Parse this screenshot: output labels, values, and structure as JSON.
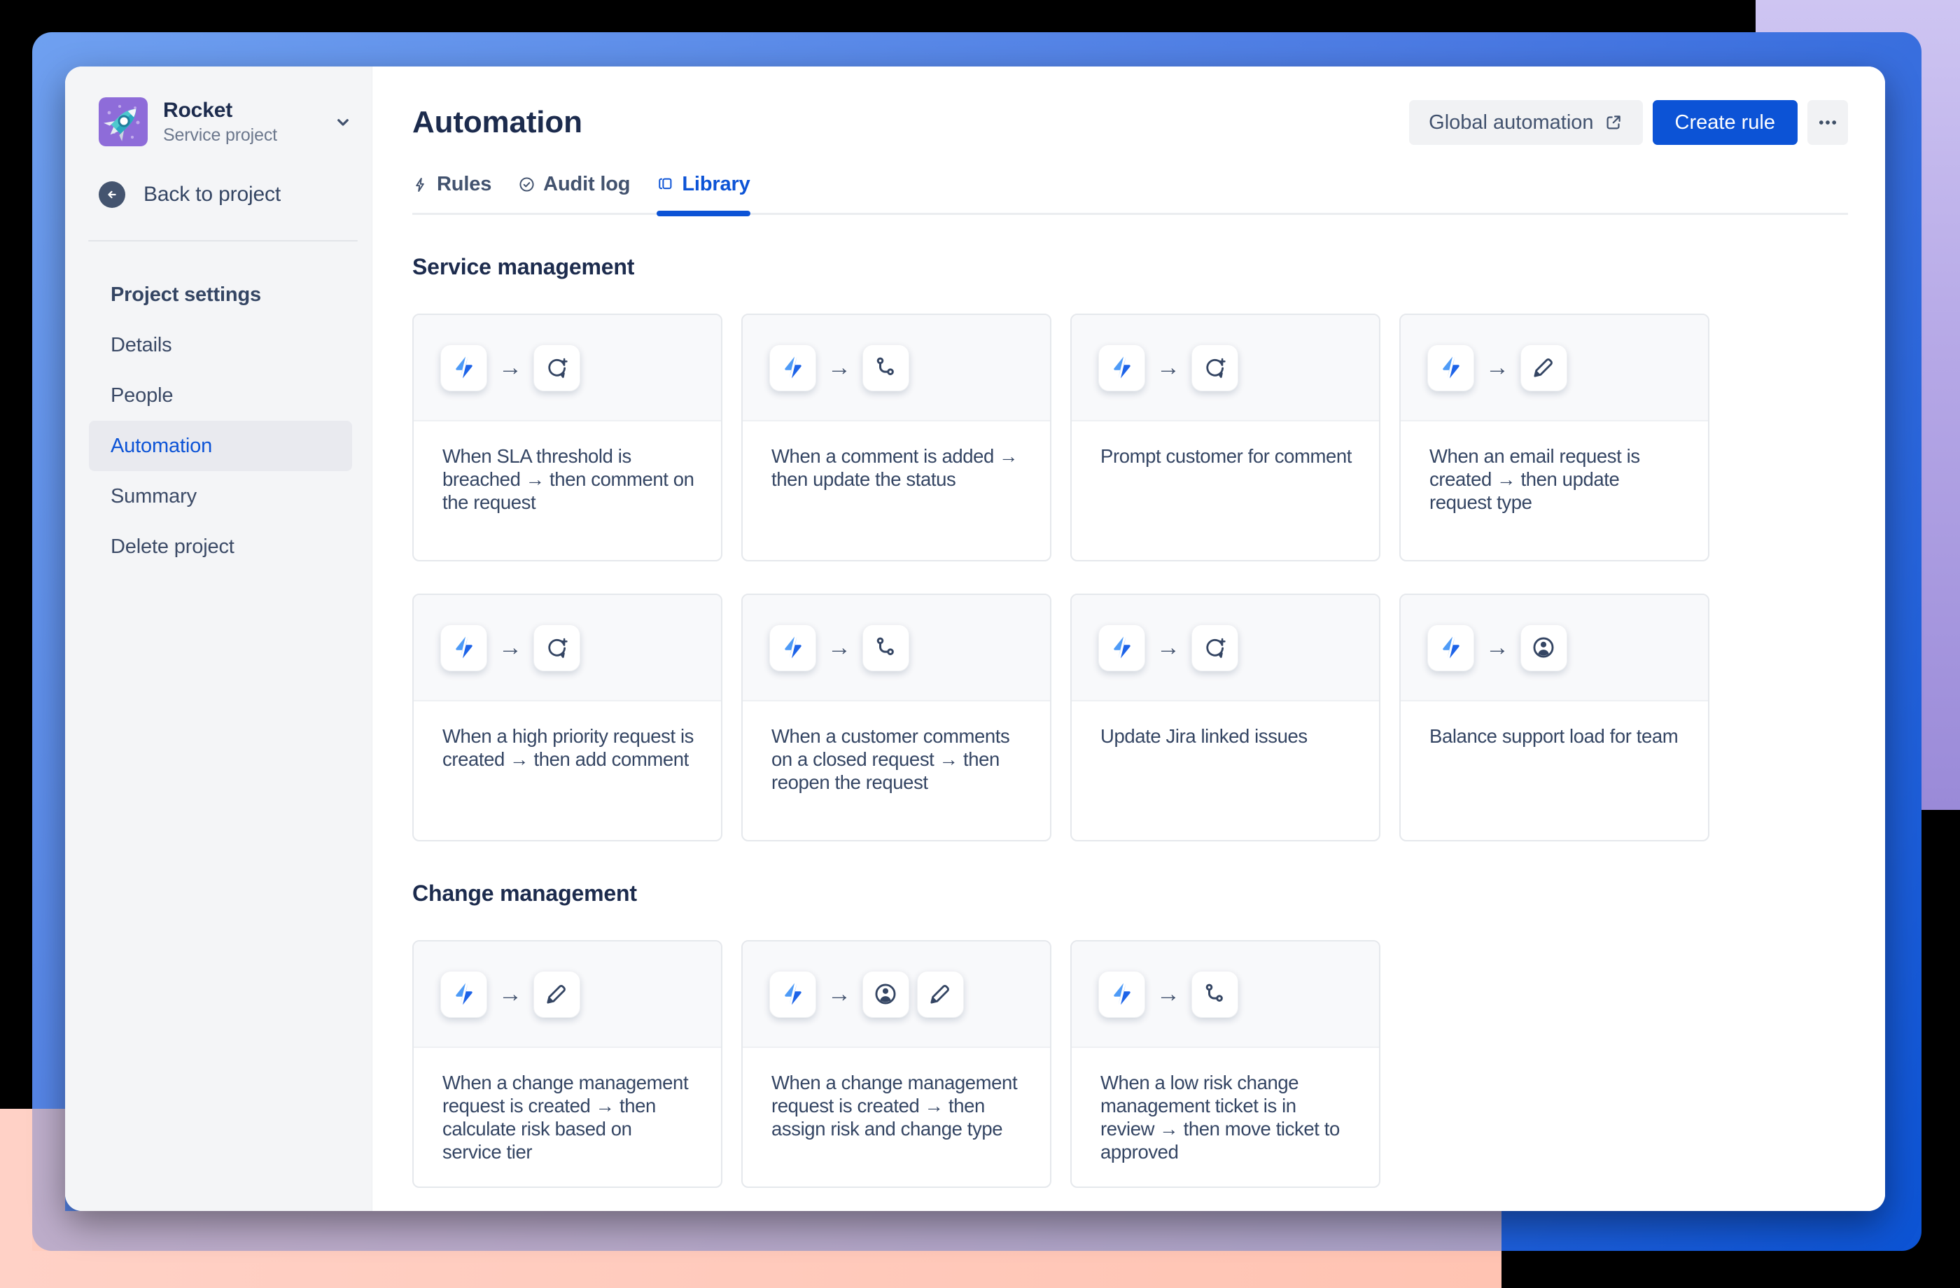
{
  "ui": {
    "arrow_glyph": "→",
    "chevron_glyph": "⌄"
  },
  "colors": {
    "accent_blue": "#0C53D6",
    "frame_blue_light": "#6FA0F0",
    "frame_blue_dark": "#0C53D4",
    "purple_band": "#AD9FE2",
    "pink_band": "#FFC9BB",
    "avatar_purple": "#8E6CD9",
    "sidebar_bg": "#F4F5F7",
    "text_dark": "#1C2B4D",
    "text_mid": "#344563"
  },
  "sidebar": {
    "project": {
      "name": "Rocket",
      "type": "Service project"
    },
    "back_label": "Back to project",
    "items": [
      {
        "label": "Project settings",
        "heading": true
      },
      {
        "label": "Details"
      },
      {
        "label": "People"
      },
      {
        "label": "Automation",
        "active": true
      },
      {
        "label": "Summary"
      },
      {
        "label": "Delete project"
      }
    ]
  },
  "header": {
    "title": "Automation",
    "global_automation_label": "Global automation",
    "create_rule_label": "Create rule"
  },
  "tabs": [
    {
      "label": "Rules",
      "icon": "lightning-outline-icon",
      "active": false
    },
    {
      "label": "Audit log",
      "icon": "check-circle-icon",
      "active": false
    },
    {
      "label": "Library",
      "icon": "library-icon",
      "active": true
    }
  ],
  "sections": [
    {
      "title": "Service management",
      "cards": [
        {
          "text": "When SLA threshold is breached → then comment on the request",
          "icons": [
            "automation-trigger",
            "add-comment"
          ]
        },
        {
          "text": "When a comment is added → then update the status",
          "icons": [
            "automation-trigger",
            "status-transition"
          ]
        },
        {
          "text": "Prompt customer for comment",
          "icons": [
            "automation-trigger",
            "add-comment"
          ]
        },
        {
          "text": "When an email request is created → then update request type",
          "icons": [
            "automation-trigger",
            "edit"
          ]
        },
        {
          "text": "When a high priority request is created → then add comment",
          "icons": [
            "automation-trigger",
            "add-comment"
          ]
        },
        {
          "text": "When a customer comments on a closed request → then reopen the request",
          "icons": [
            "automation-trigger",
            "status-transition"
          ]
        },
        {
          "text": "Update Jira linked issues",
          "icons": [
            "automation-trigger",
            "add-comment"
          ]
        },
        {
          "text": "Balance support load for team",
          "icons": [
            "automation-trigger",
            "person"
          ]
        }
      ]
    },
    {
      "title": "Change management",
      "cards": [
        {
          "text": "When a change management request is created → then calculate risk based on service tier",
          "icons": [
            "automation-trigger",
            "edit"
          ]
        },
        {
          "text": "When a change management request is created → then assign risk and change type",
          "icons": [
            "automation-trigger",
            "person",
            "edit"
          ]
        },
        {
          "text": "When a low risk change management ticket is in review → then move ticket to approved",
          "icons": [
            "automation-trigger",
            "status-transition"
          ]
        }
      ]
    }
  ]
}
